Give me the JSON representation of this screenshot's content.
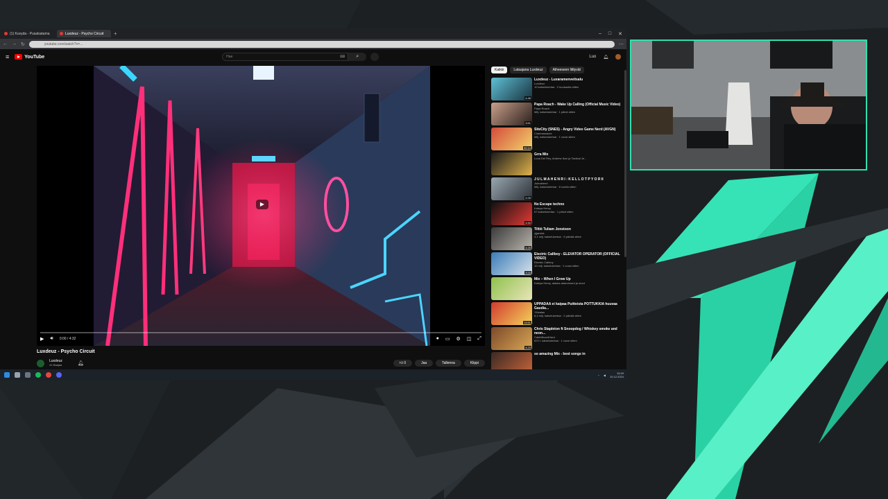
{
  "browser": {
    "tabs": [
      {
        "label": "(1) Kuvyda - Pusalsatama"
      },
      {
        "label": "Luxdeuz - Psycho Circuit"
      }
    ],
    "tab_add": "+",
    "window_controls": [
      "–",
      "□",
      "✕"
    ],
    "url": "youtube.com/watch?v=..."
  },
  "youtube": {
    "logo_text": "YouTube",
    "search_placeholder": "Hae",
    "signin_label": "Luo"
  },
  "player": {
    "time": "0:00 / 4:32",
    "progress_fraction": 0.0
  },
  "video": {
    "title": "Luxdeuz - Psycho Circuit",
    "channel": "Luxdeuz",
    "subscribers": "41 tilaajaa",
    "likes": "0",
    "share_label": "Jaa",
    "save_label": "Tallenna",
    "clip_label": "Klippi"
  },
  "sidebar": {
    "chips": [
      "Kaikki",
      "Lataajana Luxdeuz",
      "Aiheeseen liittyvät"
    ],
    "items": [
      {
        "title": "Luxdeuz - Luxaramenveitsalu",
        "channel": "Luxdeuz",
        "stats": "10 katselukertaa · 2 kuukautta sitten",
        "duration": "4:46"
      },
      {
        "title": "Papa Roach - Wake Up Calling (Official Music Video)",
        "channel": "Papa Roach",
        "stats": "Milj. katselukertaa · 1 päivä sitten",
        "duration": "3:51"
      },
      {
        "title": "SiteCity (SNES) - Angry Video Game Nerd (AVGN)",
        "channel": "Cinemassacre",
        "stats": "Milj. katselukertaa · 1 vuosi sitten",
        "duration": "32:14"
      },
      {
        "title": "Grra Mix",
        "channel": "Luna Del Rey, Andrew Ikon ja Tactical Je...",
        "stats": "",
        "duration": ""
      },
      {
        "title": "J U L M A H E N R I : K E L L O T P Y Ö R II",
        "channel": "Julmahenri",
        "stats": "Milj. katselukertaa · 8 vuotta sitten",
        "duration": "2:25"
      },
      {
        "title": "No Escape techno",
        "channel": "Kaleya Henry",
        "stats": "67 katselukertaa · 1 päivä sitten",
        "duration": "4:50"
      },
      {
        "title": "Tiltiö Tuliam Jonstoon",
        "channel": "ojjamlek",
        "stats": "3,1 milj. katselukertaa · 9 päivää sitten",
        "duration": "4:25"
      },
      {
        "title": "Electric Callboy - ELEVATOR OPERATOR (OFFICIAL VIDEO)",
        "channel": "Electric Callboy",
        "stats": "10 milj. katselukertaa · 1 vuosi sitten",
        "duration": "3:16"
      },
      {
        "title": "Mix – When I Grow Up",
        "channel": "Kaleya Henry, alaska abandoned ja muut",
        "stats": "",
        "duration": ""
      },
      {
        "title": "UPPADAA ei kaipaa Puitteista POTTUKKIA huuvaa Gaudia...",
        "channel": "Ylösalas",
        "stats": "8,4 milj. katselukertaa · 2 päivää sitten",
        "duration": "13:51"
      },
      {
        "title": "Chris Stapleton ft Snoopdog / Whiskey smoke and neon...",
        "channel": "CalebBoardHard",
        "stats": "623 t. katselukertaa · 1 vuosi sitten",
        "duration": "4:23"
      },
      {
        "title": "so amazing Mix - best songs in",
        "channel": "",
        "stats": "",
        "duration": ""
      }
    ]
  },
  "taskbar": {
    "time": "15:49",
    "date": "10.12.2024"
  },
  "colors": {
    "accent": "#2fe0b0",
    "youtube_red": "#ff0000",
    "stream_bg": "#1a1d1f"
  }
}
